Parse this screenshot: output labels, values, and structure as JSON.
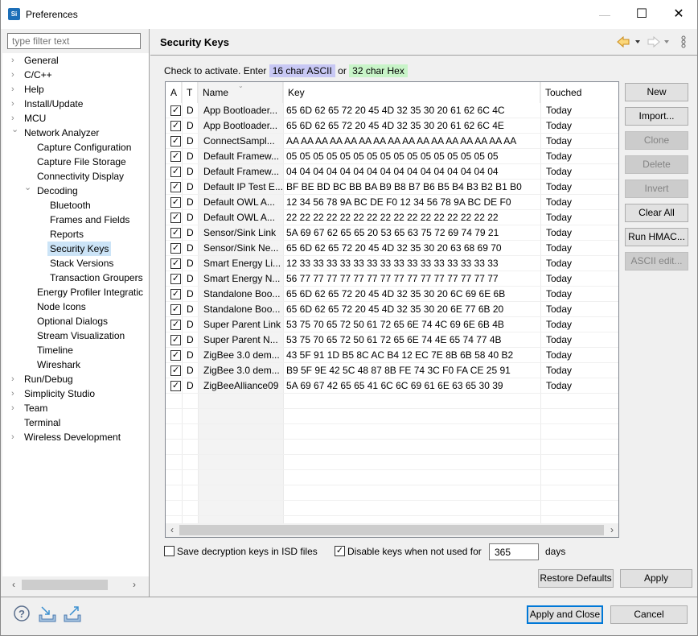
{
  "window": {
    "title": "Preferences",
    "app_icon_text": "Si",
    "minimize": "—",
    "maximize": "☐",
    "close": "✕"
  },
  "sidebar": {
    "filter_placeholder": "type filter text",
    "items": [
      {
        "label": "General",
        "level": 0,
        "expander": "collapsed"
      },
      {
        "label": "C/C++",
        "level": 0,
        "expander": "collapsed"
      },
      {
        "label": "Help",
        "level": 0,
        "expander": "collapsed"
      },
      {
        "label": "Install/Update",
        "level": 0,
        "expander": "collapsed"
      },
      {
        "label": "MCU",
        "level": 0,
        "expander": "collapsed"
      },
      {
        "label": "Network Analyzer",
        "level": 0,
        "expander": "expanded"
      },
      {
        "label": "Capture Configuration",
        "level": 1,
        "expander": "none"
      },
      {
        "label": "Capture File Storage",
        "level": 1,
        "expander": "none"
      },
      {
        "label": "Connectivity Display",
        "level": 1,
        "expander": "none"
      },
      {
        "label": "Decoding",
        "level": 1,
        "expander": "expanded"
      },
      {
        "label": "Bluetooth",
        "level": 2,
        "expander": "none"
      },
      {
        "label": "Frames and Fields",
        "level": 2,
        "expander": "none"
      },
      {
        "label": "Reports",
        "level": 2,
        "expander": "none"
      },
      {
        "label": "Security Keys",
        "level": 2,
        "expander": "none",
        "selected": true
      },
      {
        "label": "Stack Versions",
        "level": 2,
        "expander": "none"
      },
      {
        "label": "Transaction Groupers",
        "level": 2,
        "expander": "none"
      },
      {
        "label": "Energy Profiler Integratic",
        "level": 1,
        "expander": "none"
      },
      {
        "label": "Node Icons",
        "level": 1,
        "expander": "none"
      },
      {
        "label": "Optional Dialogs",
        "level": 1,
        "expander": "none"
      },
      {
        "label": "Stream Visualization",
        "level": 1,
        "expander": "none"
      },
      {
        "label": "Timeline",
        "level": 1,
        "expander": "none"
      },
      {
        "label": "Wireshark",
        "level": 1,
        "expander": "none"
      },
      {
        "label": "Run/Debug",
        "level": 0,
        "expander": "collapsed"
      },
      {
        "label": "Simplicity Studio",
        "level": 0,
        "expander": "collapsed"
      },
      {
        "label": "Team",
        "level": 0,
        "expander": "collapsed"
      },
      {
        "label": "Terminal",
        "level": 0,
        "expander": "none"
      },
      {
        "label": "Wireless Development",
        "level": 0,
        "expander": "collapsed"
      }
    ]
  },
  "page": {
    "title": "Security Keys",
    "instruction_prefix": "Check to activate. Enter",
    "ascii_badge": "16 char ASCII",
    "or_text": "or",
    "hex_badge": "32 char Hex",
    "ascii_color": "#c8c8f4",
    "hex_color": "#c8f4c8"
  },
  "table": {
    "columns": [
      "A",
      "T",
      "Name",
      "Key",
      "Touched"
    ],
    "rows": [
      {
        "active": true,
        "type": "D",
        "name": "App Bootloader...",
        "key": "65 6D 62 65 72 20 45 4D 32 35 30 20 61 62 6C 4C",
        "touched": "Today"
      },
      {
        "active": true,
        "type": "D",
        "name": "App Bootloader...",
        "key": "65 6D 62 65 72 20 45 4D 32 35 30 20 61 62 6C 4E",
        "touched": "Today"
      },
      {
        "active": true,
        "type": "D",
        "name": "ConnectSampl...",
        "key": "AA AA AA AA AA AA AA AA AA AA AA AA AA AA AA AA",
        "touched": "Today"
      },
      {
        "active": true,
        "type": "D",
        "name": "Default Framew...",
        "key": "05 05 05 05 05 05 05 05 05 05 05 05 05 05 05 05",
        "touched": "Today"
      },
      {
        "active": true,
        "type": "D",
        "name": "Default Framew...",
        "key": "04 04 04 04 04 04 04 04 04 04 04 04 04 04 04 04",
        "touched": "Today"
      },
      {
        "active": true,
        "type": "D",
        "name": "Default IP Test E...",
        "key": "BF BE BD BC BB BA B9 B8 B7 B6 B5 B4 B3 B2 B1 B0",
        "touched": "Today"
      },
      {
        "active": true,
        "type": "D",
        "name": "Default OWL A...",
        "key": "12 34 56 78 9A BC DE F0 12 34 56 78 9A BC DE F0",
        "touched": "Today"
      },
      {
        "active": true,
        "type": "D",
        "name": "Default OWL A...",
        "key": "22 22 22 22 22 22 22 22 22 22 22 22 22 22 22 22",
        "touched": "Today"
      },
      {
        "active": true,
        "type": "D",
        "name": "Sensor/Sink Link",
        "key": "5A 69 67 62 65 65 20 53 65 63 75 72 69 74 79 21",
        "touched": "Today"
      },
      {
        "active": true,
        "type": "D",
        "name": "Sensor/Sink Ne...",
        "key": "65 6D 62 65 72 20 45 4D 32 35 30 20 63 68 69 70",
        "touched": "Today"
      },
      {
        "active": true,
        "type": "D",
        "name": "Smart Energy Li...",
        "key": "12 33 33 33 33 33 33 33 33 33 33 33 33 33 33 33",
        "touched": "Today"
      },
      {
        "active": true,
        "type": "D",
        "name": "Smart Energy N...",
        "key": "56 77 77 77 77 77 77 77 77 77 77 77 77 77 77 77",
        "touched": "Today"
      },
      {
        "active": true,
        "type": "D",
        "name": "Standalone Boo...",
        "key": "65 6D 62 65 72 20 45 4D 32 35 30 20 6C 69 6E 6B",
        "touched": "Today"
      },
      {
        "active": true,
        "type": "D",
        "name": "Standalone Boo...",
        "key": "65 6D 62 65 72 20 45 4D 32 35 30 20 6E 77 6B 20",
        "touched": "Today"
      },
      {
        "active": true,
        "type": "D",
        "name": "Super Parent Link",
        "key": "53 75 70 65 72 50 61 72 65 6E 74 4C 69 6E 6B 4B",
        "touched": "Today"
      },
      {
        "active": true,
        "type": "D",
        "name": "Super Parent N...",
        "key": "53 75 70 65 72 50 61 72 65 6E 74 4E 65 74 77 4B",
        "touched": "Today"
      },
      {
        "active": true,
        "type": "D",
        "name": "ZigBee 3.0 dem...",
        "key": "43 5F 91 1D B5 8C AC B4 12 EC 7E 8B 6B 58 40 B2",
        "touched": "Today"
      },
      {
        "active": true,
        "type": "D",
        "name": "ZigBee 3.0 dem...",
        "key": "B9 5F 9E 42 5C 48 87 8B FE 74 3C F0 FA CE 25 91",
        "touched": "Today"
      },
      {
        "active": true,
        "type": "D",
        "name": "ZigBeeAlliance09",
        "key": "5A 69 67 42 65 65 41 6C 6C 69 61 6E 63 65 30 39",
        "touched": "Today"
      }
    ]
  },
  "side_buttons": [
    {
      "label": "New",
      "enabled": true
    },
    {
      "label": "Import...",
      "enabled": true
    },
    {
      "label": "Clone",
      "enabled": false
    },
    {
      "label": "Delete",
      "enabled": false
    },
    {
      "label": "Invert",
      "enabled": false
    },
    {
      "label": "Clear All",
      "enabled": true
    },
    {
      "label": "Run HMAC...",
      "enabled": true
    },
    {
      "label": "ASCII edit...",
      "enabled": false
    }
  ],
  "options": {
    "save_keys_label": "Save decryption keys in ISD files",
    "save_keys_checked": false,
    "disable_keys_label": "Disable keys when not used for",
    "disable_keys_checked": true,
    "days_value": "365",
    "days_unit": "days"
  },
  "buttons": {
    "restore_defaults": "Restore Defaults",
    "apply": "Apply",
    "apply_and_close": "Apply and Close",
    "cancel": "Cancel"
  }
}
